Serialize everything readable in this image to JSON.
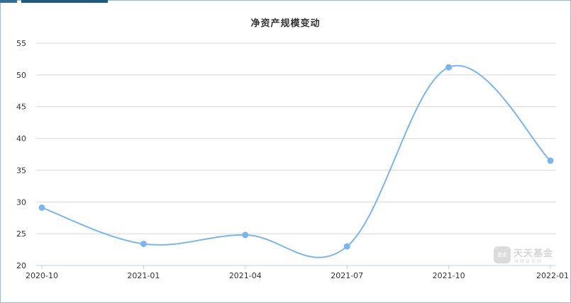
{
  "chart_data": {
    "type": "line",
    "title": "净资产规模变动",
    "xlabel": "",
    "ylabel": "",
    "categories": [
      "2020-10",
      "2021-01",
      "2021-04",
      "2021-07",
      "2021-10",
      "2022-01"
    ],
    "x_tick_labels": [
      "2020-10",
      "2021-01",
      "2021-04",
      "2021-07",
      "2021-10",
      "2022-01"
    ],
    "series": [
      {
        "values": [
          29.1,
          23.4,
          24.8,
          23.0,
          51.2,
          36.5
        ]
      }
    ],
    "ylim": [
      20,
      55
    ],
    "y_ticks": [
      20,
      25,
      30,
      35,
      40,
      45,
      50,
      55
    ],
    "grid": true,
    "legend": "none",
    "line_color": "#7cb5ec"
  },
  "watermark": {
    "badge": "基金",
    "name": "天天基金",
    "tagline": "财经自投顾"
  }
}
